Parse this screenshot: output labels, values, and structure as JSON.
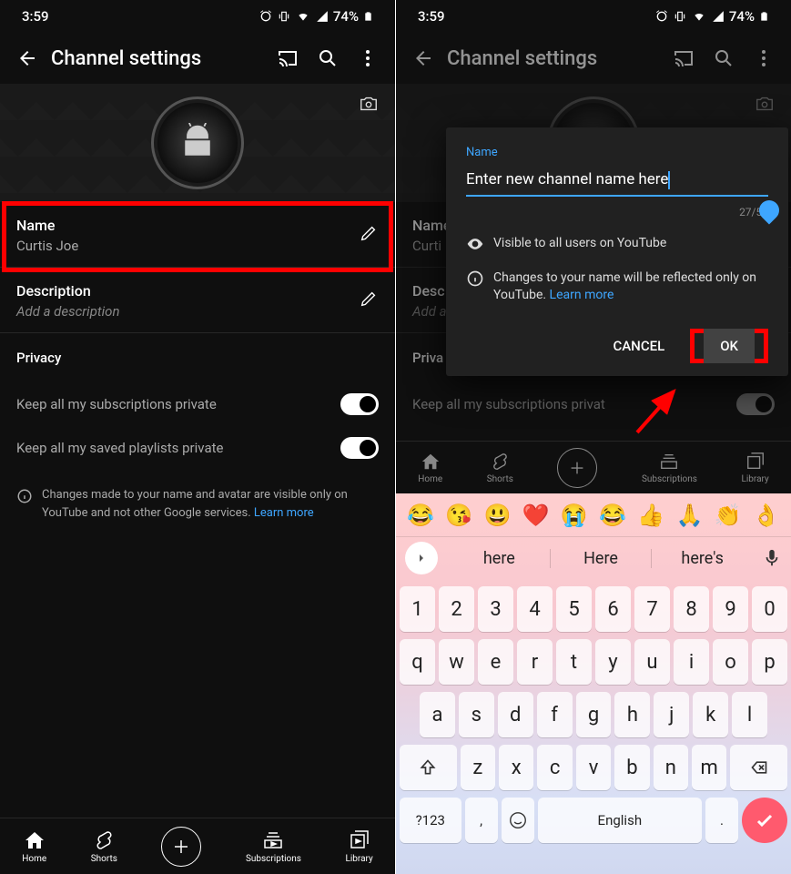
{
  "status": {
    "time": "3:59",
    "battery": "74%"
  },
  "appbar": {
    "title": "Channel settings"
  },
  "name_section": {
    "label": "Name",
    "value": "Curtis Joe"
  },
  "desc_section": {
    "label": "Description",
    "placeholder": "Add a description"
  },
  "privacy": {
    "header": "Privacy",
    "subs_label": "Keep all my subscriptions private",
    "playlists_label": "Keep all my saved playlists private"
  },
  "info_note": {
    "text": "Changes made to your name and avatar are visible only on YouTube and not other Google services. ",
    "link": "Learn more"
  },
  "nav": {
    "home": "Home",
    "shorts": "Shorts",
    "subs": "Subscriptions",
    "lib": "Library"
  },
  "dialog": {
    "label": "Name",
    "input": "Enter new channel name here",
    "counter": "27/50",
    "note1": "Visible to all users on YouTube",
    "note2": "Changes to your name will be reflected only on YouTube. ",
    "link2": "Learn more",
    "cancel": "CANCEL",
    "ok": "OK"
  },
  "name_section2": {
    "label": "Name",
    "value_partial": "Curti"
  },
  "desc_section2": {
    "label": "Desc",
    "placeholder_partial": "Add a"
  },
  "privacy2": {
    "header_partial": "Priva",
    "subs_partial": "Keep all my subscriptions privat"
  },
  "keyboard": {
    "emojis": [
      "😂",
      "😘",
      "😃",
      "❤️",
      "😭",
      "😂",
      "👍",
      "🙏",
      "👏",
      "👌"
    ],
    "suggestions": [
      "here",
      "Here",
      "here's"
    ],
    "row1": [
      "1",
      "2",
      "3",
      "4",
      "5",
      "6",
      "7",
      "8",
      "9",
      "0"
    ],
    "row2": [
      "q",
      "w",
      "e",
      "r",
      "t",
      "y",
      "u",
      "i",
      "o",
      "p"
    ],
    "row3": [
      "a",
      "s",
      "d",
      "f",
      "g",
      "h",
      "j",
      "k",
      "l"
    ],
    "row4": [
      "z",
      "x",
      "c",
      "v",
      "b",
      "n",
      "m"
    ],
    "sym": "?123",
    "lang": "English"
  }
}
